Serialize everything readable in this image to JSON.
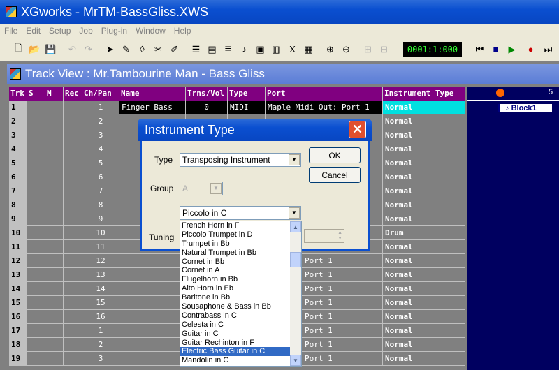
{
  "app": {
    "title": "XGworks - MrTM-BassGliss.XWS"
  },
  "menu": [
    "File",
    "Edit",
    "Setup",
    "Job",
    "Plug-in",
    "Window",
    "Help"
  ],
  "toolbar": {
    "counter": "0001:1:000"
  },
  "child": {
    "title": "Track View : Mr.Tambourine Man - Bass Gliss"
  },
  "grid": {
    "headers": [
      "Trk",
      "S",
      "M",
      "Rec",
      "Ch/Pan",
      "Name",
      "Trns/Vol",
      "Type",
      "Port",
      "Instrument Type"
    ],
    "rows": [
      {
        "trk": "1",
        "ch": "1",
        "name": "Finger Bass",
        "trns": "0",
        "type": "MIDI",
        "port": "Maple Midi Out: Port 1",
        "inst": "Normal"
      },
      {
        "trk": "2",
        "ch": "2",
        "name": "",
        "trns": "",
        "type": "",
        "port": "",
        "inst": "Normal"
      },
      {
        "trk": "3",
        "ch": "3",
        "name": "",
        "trns": "",
        "type": "",
        "port": "",
        "inst": "Normal"
      },
      {
        "trk": "4",
        "ch": "4",
        "name": "",
        "trns": "",
        "type": "",
        "port": "",
        "inst": "Normal"
      },
      {
        "trk": "5",
        "ch": "5",
        "name": "",
        "trns": "",
        "type": "",
        "port": "",
        "inst": "Normal"
      },
      {
        "trk": "6",
        "ch": "6",
        "name": "",
        "trns": "",
        "type": "",
        "port": "",
        "inst": "Normal"
      },
      {
        "trk": "7",
        "ch": "7",
        "name": "",
        "trns": "",
        "type": "",
        "port": "",
        "inst": "Normal"
      },
      {
        "trk": "8",
        "ch": "8",
        "name": "",
        "trns": "",
        "type": "",
        "port": "",
        "inst": "Normal"
      },
      {
        "trk": "9",
        "ch": "9",
        "name": "",
        "trns": "",
        "type": "",
        "port": "",
        "inst": "Normal"
      },
      {
        "trk": "10",
        "ch": "10",
        "name": "",
        "trns": "",
        "type": "",
        "port": "",
        "inst": "Drum"
      },
      {
        "trk": "11",
        "ch": "11",
        "name": "",
        "trns": "",
        "type": "",
        "port": "",
        "inst": "Normal"
      },
      {
        "trk": "12",
        "ch": "12",
        "name": "",
        "trns": "",
        "type": "",
        "port": "di Out: Port 1",
        "inst": "Normal"
      },
      {
        "trk": "13",
        "ch": "13",
        "name": "",
        "trns": "",
        "type": "",
        "port": "di Out: Port 1",
        "inst": "Normal"
      },
      {
        "trk": "14",
        "ch": "14",
        "name": "",
        "trns": "",
        "type": "",
        "port": "di Out: Port 1",
        "inst": "Normal"
      },
      {
        "trk": "15",
        "ch": "15",
        "name": "",
        "trns": "",
        "type": "",
        "port": "di Out: Port 1",
        "inst": "Normal"
      },
      {
        "trk": "16",
        "ch": "16",
        "name": "",
        "trns": "",
        "type": "",
        "port": "di Out: Port 1",
        "inst": "Normal"
      },
      {
        "trk": "17",
        "ch": "1",
        "name": "",
        "trns": "",
        "type": "",
        "port": "di Out: Port 1",
        "inst": "Normal"
      },
      {
        "trk": "18",
        "ch": "2",
        "name": "",
        "trns": "",
        "type": "",
        "port": "di Out: Port 1",
        "inst": "Normal"
      },
      {
        "trk": "19",
        "ch": "3",
        "name": "",
        "trns": "",
        "type": "",
        "port": "di Out: Port 1",
        "inst": "Normal"
      }
    ]
  },
  "song": {
    "marker": "5",
    "block": "Block1"
  },
  "dialog": {
    "title": "Instrument Type",
    "type_label": "Type",
    "type_value": "Transposing Instrument",
    "group_label": "Group",
    "group_value": "A",
    "instrument_value": "Piccolo in C",
    "tuning_label": "Tuning",
    "ok": "OK",
    "cancel": "Cancel",
    "list": [
      "French Horn in F",
      "Piccolo Trumpet in D",
      "Trumpet in Bb",
      "Natural Trumpet in Bb",
      "Cornet in Bb",
      "Cornet in A",
      "Flugelhorn in Bb",
      "Alto Horn in Eb",
      "Baritone in Bb",
      "Sousaphone & Bass in Bb",
      "Contrabass in C",
      "Celesta in C",
      "Guitar in C",
      "Guitar Rechinton in F",
      "Electric Bass Guitar in C",
      "Mandolin in C"
    ],
    "selected_index": 14
  }
}
